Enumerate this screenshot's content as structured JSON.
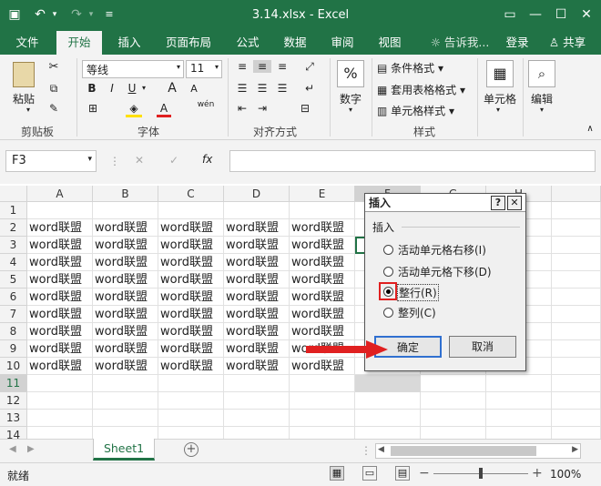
{
  "window": {
    "title": "3.14.xlsx - Excel"
  },
  "tabs": [
    "文件",
    "开始",
    "插入",
    "页面布局",
    "公式",
    "数据",
    "审阅",
    "视图"
  ],
  "active_tab": "开始",
  "tell_me": "告诉我...",
  "login": "登录",
  "share": "共享",
  "ribbon": {
    "paste": "粘贴",
    "font_name": "等线",
    "font_size": "11",
    "bold": "B",
    "italic": "I",
    "underline": "U",
    "wen": "wén",
    "percent_label": "数字",
    "cond_format": "条件格式",
    "table_format": "套用表格格式",
    "cell_style": "单元格样式",
    "cells": "单元格",
    "edit": "编辑",
    "groups": [
      "剪贴板",
      "字体",
      "对齐方式",
      "数字",
      "样式",
      "单元格",
      "编辑"
    ]
  },
  "formula_bar": {
    "name_box": "F3",
    "fx": "fx",
    "cancel": "✕",
    "confirm": "✓"
  },
  "columns": [
    "A",
    "B",
    "C",
    "D",
    "E",
    "F",
    "G",
    "H"
  ],
  "rows": [
    "1",
    "2",
    "3",
    "4",
    "5",
    "6",
    "7",
    "8",
    "9",
    "10",
    "11",
    "12",
    "13",
    "14"
  ],
  "cell_text": "word联盟",
  "sheet_tab": "Sheet1",
  "status": {
    "ready": "就绪",
    "zoom": "100%"
  },
  "dialog": {
    "title": "插入",
    "help": "?",
    "close": "✕",
    "group": "插入",
    "options": [
      "活动单元格右移(I)",
      "活动单元格下移(D)",
      "整行(R)",
      "整列(C)"
    ],
    "selected": 2,
    "ok": "确定",
    "cancel": "取消"
  },
  "colors": {
    "accent": "#217346",
    "arrow": "#e02020",
    "highlight_box": "#e02020"
  }
}
